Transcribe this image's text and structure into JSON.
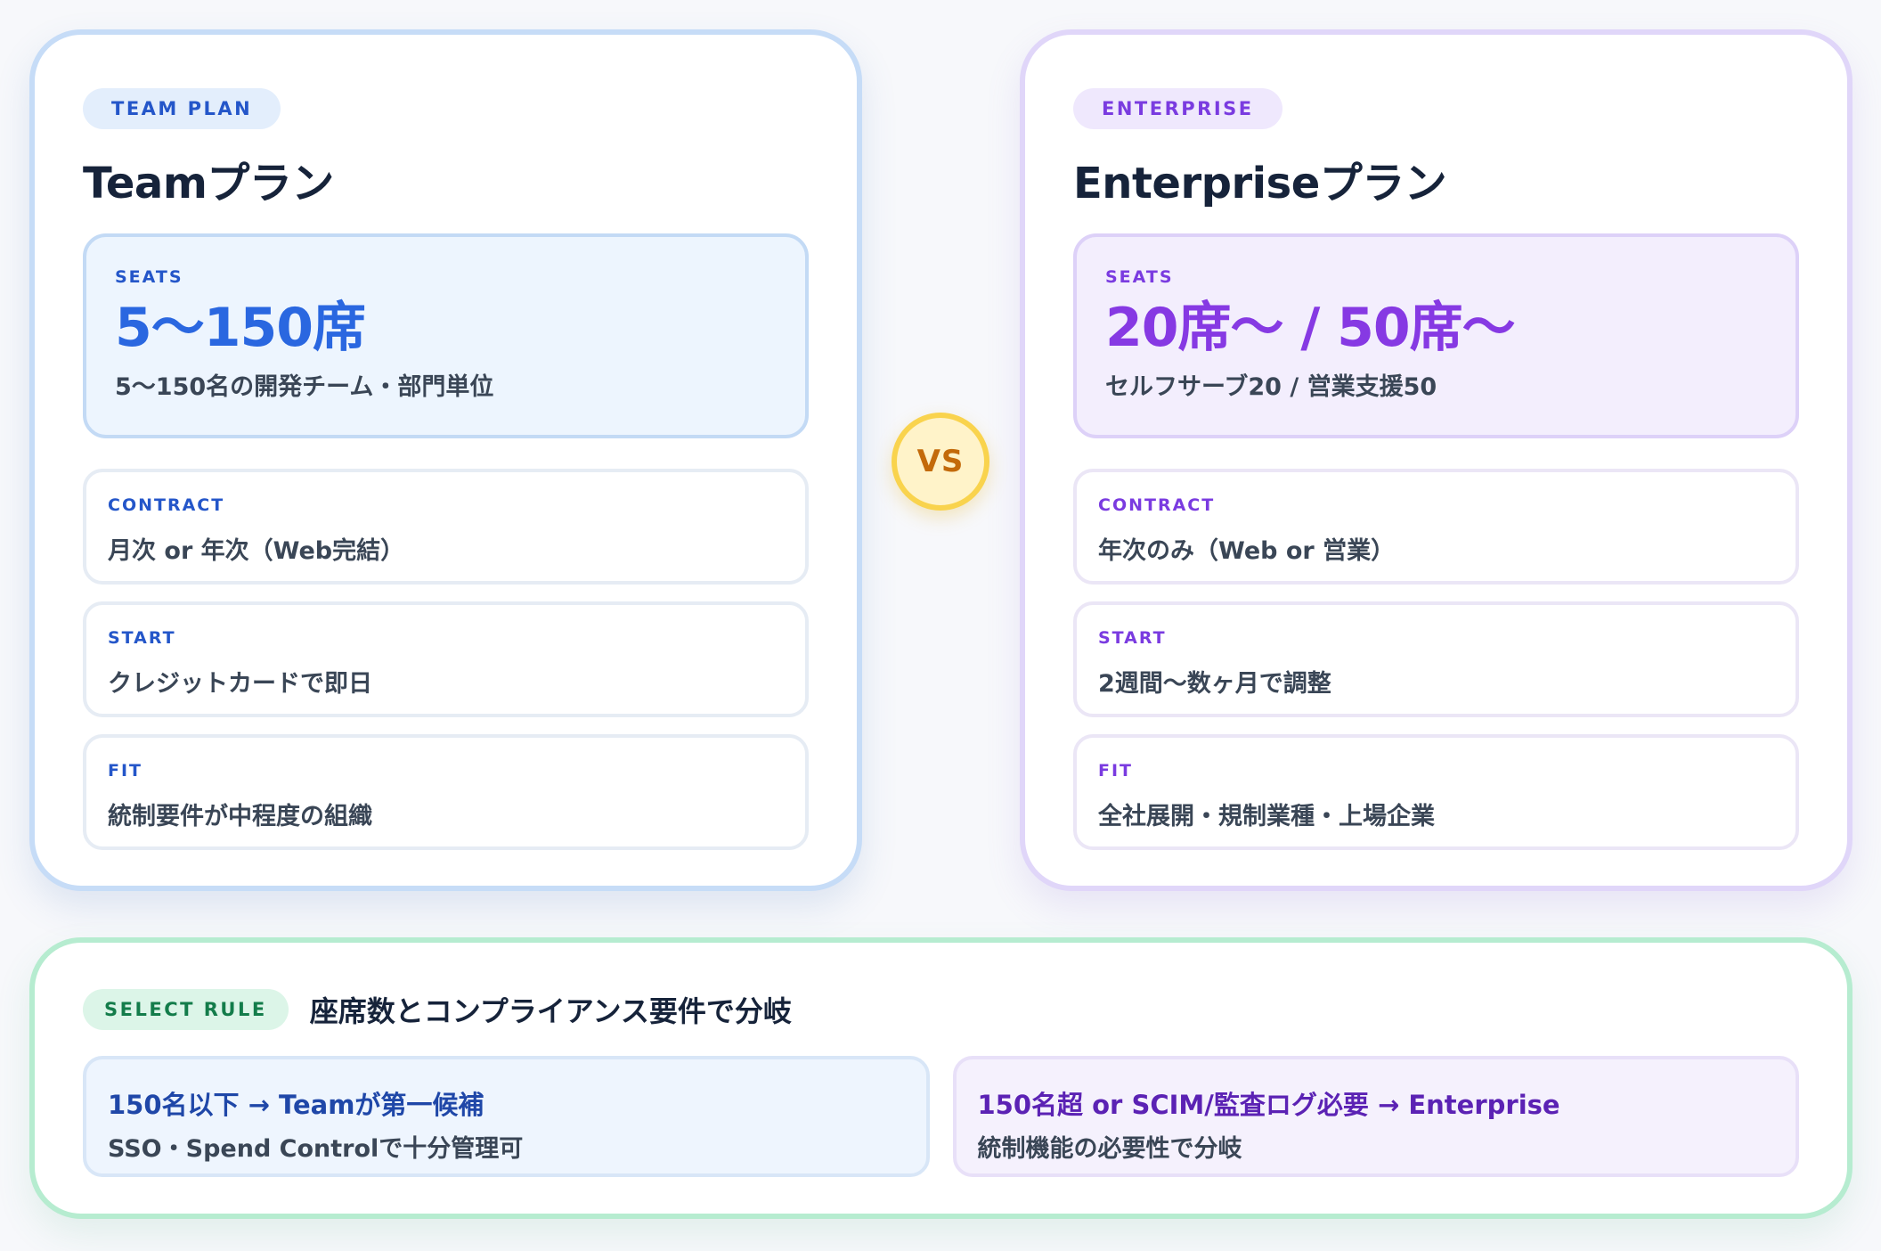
{
  "team": {
    "pill": "TEAM PLAN",
    "title": "Teamプラン",
    "seats": {
      "label": "SEATS",
      "value": "5〜150席",
      "sub": "5〜150名の開発チーム・部門単位"
    },
    "rows": [
      {
        "label": "CONTRACT",
        "value": "月次 or 年次（Web完結）"
      },
      {
        "label": "START",
        "value": "クレジットカードで即日"
      },
      {
        "label": "FIT",
        "value": "統制要件が中程度の組織"
      }
    ]
  },
  "vs": "VS",
  "enterprise": {
    "pill": "ENTERPRISE",
    "title": "Enterpriseプラン",
    "seats": {
      "label": "SEATS",
      "value": "20席〜 / 50席〜",
      "sub": "セルフサーブ20 / 営業支援50"
    },
    "rows": [
      {
        "label": "CONTRACT",
        "value": "年次のみ（Web or 営業）"
      },
      {
        "label": "START",
        "value": "2週間〜数ヶ月で調整"
      },
      {
        "label": "FIT",
        "value": "全社展開・規制業種・上場企業"
      }
    ]
  },
  "rule": {
    "pill": "SELECT RULE",
    "title": "座席数とコンプライアンス要件で分岐",
    "boxes": [
      {
        "head": "150名以下 → Teamが第一候補",
        "body": "SSO・Spend Controlで十分管理可"
      },
      {
        "head": "150名超 or SCIM/監査ログ必要 → Enterprise",
        "body": "統制機能の必要性で分岐"
      }
    ]
  }
}
